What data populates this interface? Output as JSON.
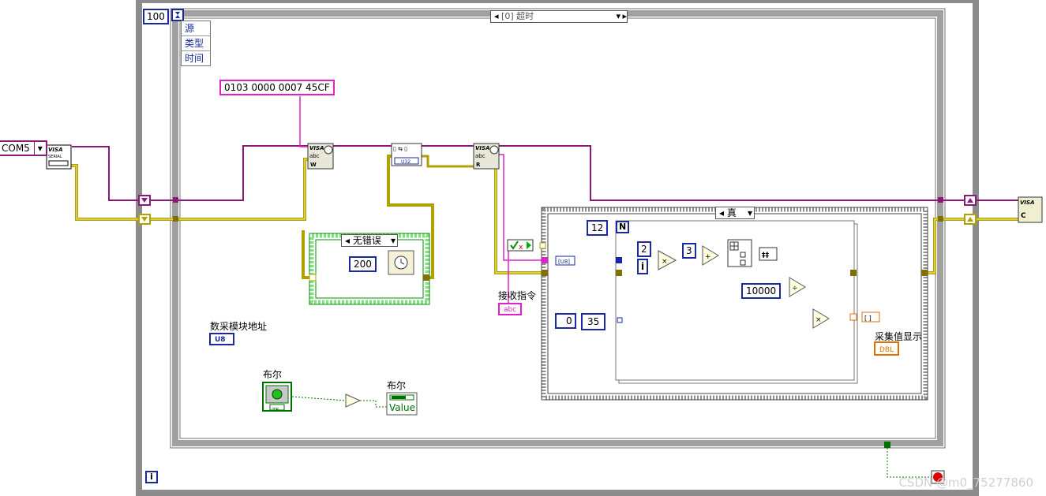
{
  "loop": {
    "count": "100",
    "info_icon": "i"
  },
  "event_structure": {
    "case_label": "[0] 超时",
    "event_data": [
      "源",
      "类型",
      "时间"
    ]
  },
  "serial": {
    "port": "COM5"
  },
  "command": {
    "hex": "0103 0000 0007 45CF"
  },
  "error_case": {
    "label": "无错误",
    "wait_ms": "200"
  },
  "true_case": {
    "label": "真",
    "count": "12",
    "count_terminal": "N",
    "index_terminal": "i",
    "mult_const": "2",
    "add_const": "3",
    "divisor": "10000",
    "subset_start": "0",
    "subset_len": "35"
  },
  "labels": {
    "receive_cmd": "接收指令",
    "acquire_display": "采集值显示",
    "module_address": "数采模块地址",
    "bool_control": "布尔",
    "bool_indicator": "布尔",
    "value_property": "Value"
  },
  "terminals": {
    "string": "abc",
    "u8": "U8",
    "dbl": "DBL",
    "tf": "TF"
  },
  "watermark": "CSDN @m0_75277860",
  "colors": {
    "border_gray": "#8c8c8c",
    "error_wire": "#b0a000",
    "visa_wire": "#8a1a7a",
    "string_wire": "#e020c8",
    "numeric_wire": "#1a2a9e",
    "boolean_wire": "#007000"
  }
}
